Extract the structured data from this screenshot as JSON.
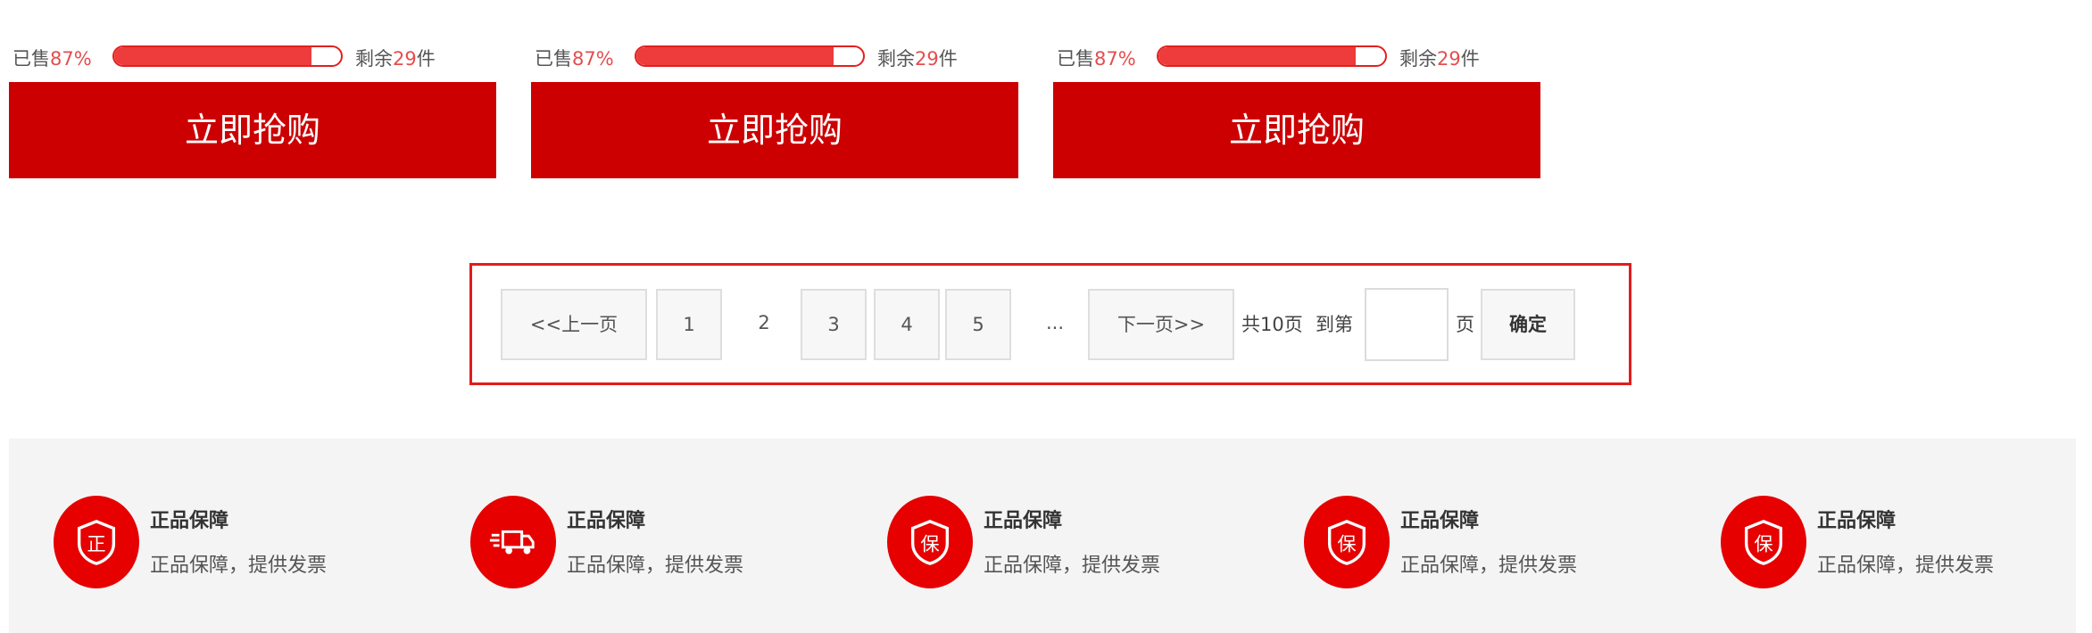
{
  "products": [
    {
      "sold_prefix": "已售",
      "sold_percent": "87%",
      "progress_fraction": 0.87,
      "remain_prefix": "剩余",
      "remain_count": "29",
      "remain_suffix": "件",
      "buy_label": "立即抢购"
    },
    {
      "sold_prefix": "已售",
      "sold_percent": "87%",
      "progress_fraction": 0.87,
      "remain_prefix": "剩余",
      "remain_count": "29",
      "remain_suffix": "件",
      "buy_label": "立即抢购"
    },
    {
      "sold_prefix": "已售",
      "sold_percent": "87%",
      "progress_fraction": 0.87,
      "remain_prefix": "剩余",
      "remain_count": "29",
      "remain_suffix": "件",
      "buy_label": "立即抢购"
    }
  ],
  "pagination": {
    "prev_label": "<<上一页",
    "pages": [
      "1",
      "2",
      "3",
      "4",
      "5"
    ],
    "current_page": "2",
    "ellipsis": "...",
    "next_label": "下一页>>",
    "total_text": "共10页",
    "goto_prefix": "到第",
    "goto_input_value": "",
    "goto_suffix": "页",
    "confirm_label": "确定"
  },
  "services": [
    {
      "icon": "authentic-icon",
      "title": "正品保障",
      "desc": "正品保障，提供发票"
    },
    {
      "icon": "delivery-truck-icon",
      "title": "正品保障",
      "desc": "正品保障，提供发票"
    },
    {
      "icon": "shield-guarantee-icon",
      "title": "正品保障",
      "desc": "正品保障，提供发票"
    },
    {
      "icon": "shield-guarantee-icon",
      "title": "正品保障",
      "desc": "正品保障，提供发票"
    },
    {
      "icon": "shield-guarantee-icon",
      "title": "正品保障",
      "desc": "正品保障，提供发票"
    }
  ],
  "colors": {
    "accent_red": "#cc0000",
    "progress_red": "#ee3b3b",
    "highlight_text": "#e54d4d",
    "footer_bg": "#f4f4f4"
  }
}
